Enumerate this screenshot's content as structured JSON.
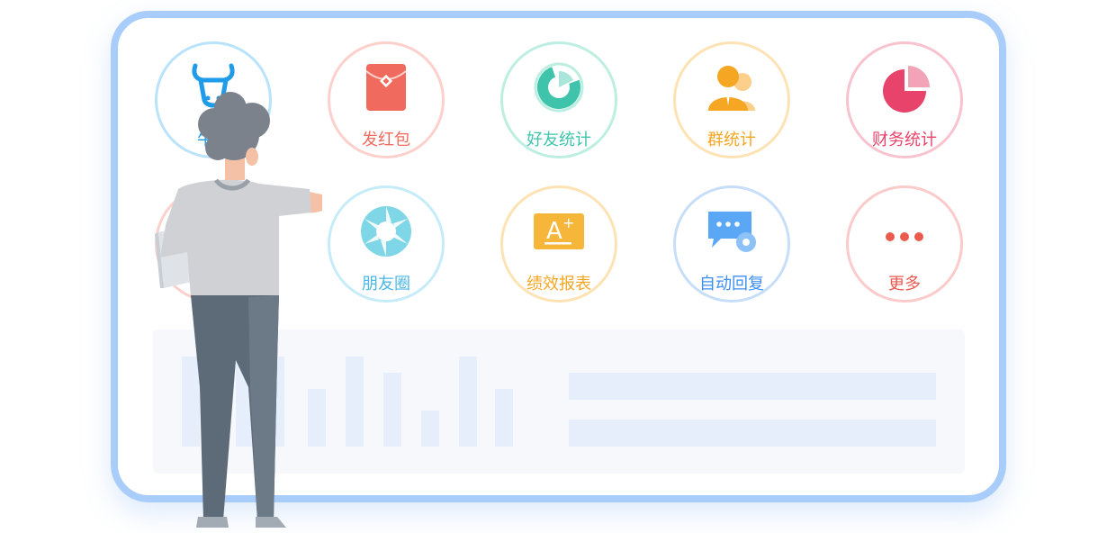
{
  "tiles": [
    {
      "id": "niuke",
      "label": "牛客",
      "color": "#1e9be9",
      "border": "#b9e3fb"
    },
    {
      "id": "hongbao",
      "label": "发红包",
      "color": "#f06b5d",
      "border": "#fdd0cb"
    },
    {
      "id": "friend_stats",
      "label": "好友统计",
      "color": "#3fc4ab",
      "border": "#bdeee2"
    },
    {
      "id": "group_stats",
      "label": "群统计",
      "color": "#f5a623",
      "border": "#fde3b4"
    },
    {
      "id": "finance_stats",
      "label": "财务统计",
      "color": "#e8436a",
      "border": "#f8c3cf"
    },
    {
      "id": "row2_left",
      "label": "",
      "color": "#f06b5d",
      "border": "#fdd0cb"
    },
    {
      "id": "moments",
      "label": "朋友圈",
      "color": "#4cb7e6",
      "border": "#c5ecf8"
    },
    {
      "id": "performance",
      "label": "绩效报表",
      "color": "#f5a623",
      "border": "#fde3b4"
    },
    {
      "id": "auto_reply",
      "label": "自动回复",
      "color": "#3c8ff0",
      "border": "#c7def9"
    },
    {
      "id": "more",
      "label": "更多",
      "color": "#ea5a4f",
      "border": "#fbcaca"
    }
  ],
  "colors": {
    "panel_border": "#a9cdfb",
    "chart_fill": "#e6eefb"
  }
}
